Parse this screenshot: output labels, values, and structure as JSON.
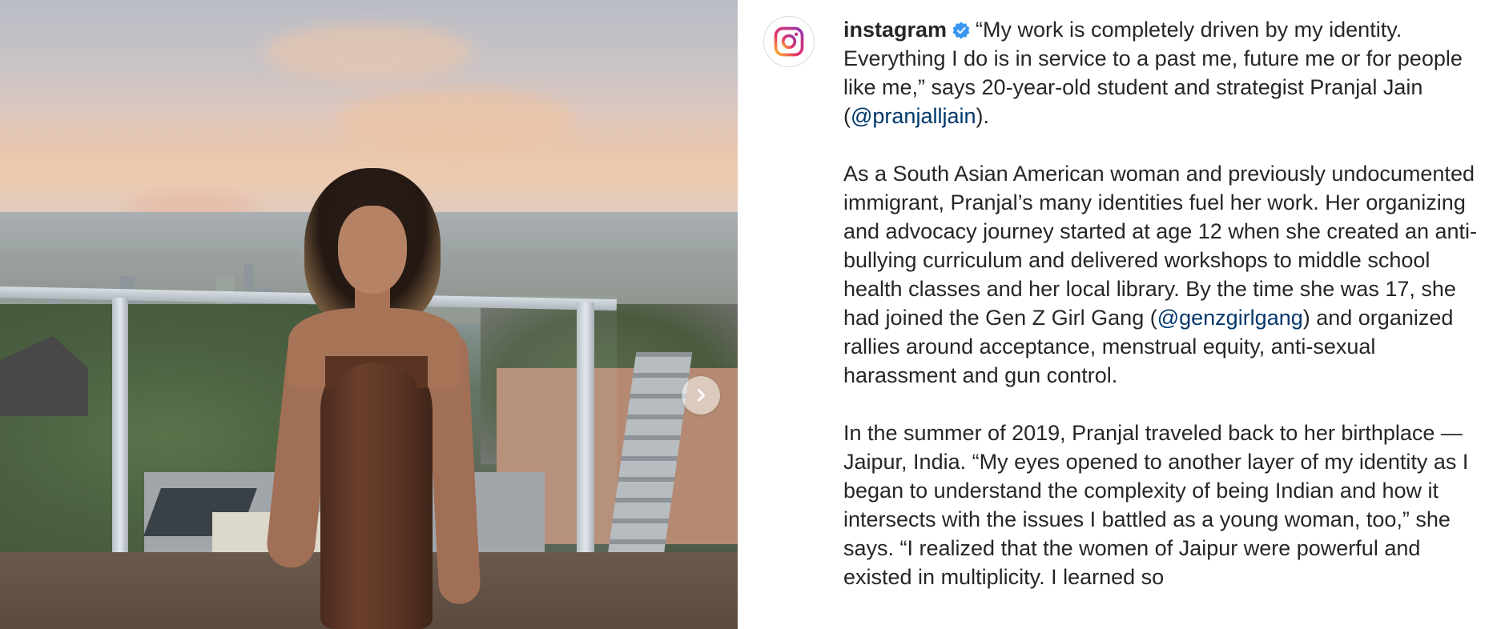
{
  "post": {
    "author": {
      "username": "instagram",
      "verified": true,
      "avatar_icon": "instagram-logo-icon",
      "verified_icon": "verified-badge-icon",
      "verified_color": "#3897f0"
    },
    "carousel": {
      "next_icon": "chevron-right-icon"
    },
    "caption": {
      "p1_a": "“My work is completely driven by my identity. Everything I do is in service to a past me, future me or for people like me,” says 20-year-old student and strategist Pranjal Jain (",
      "p1_mention": "@pranjalljain",
      "p1_b": ").",
      "p2_a": "As a South Asian American woman and previously undocumented immigrant, Pranjal’s many identities fuel her work. Her organizing and advocacy journey started at age 12 when she created an anti-bullying curriculum and delivered workshops to middle school health classes and her local library. By the time she was 17, she had joined the Gen Z Girl Gang (",
      "p2_mention": "@genzgirlgang",
      "p2_b": ") and organized rallies around acceptance, menstrual equity, anti-sexual harassment and gun control.",
      "p3": "In the summer of 2019, Pranjal traveled back to her birthplace — Jaipur, India. “My eyes opened to another layer of my identity as I began to understand the complexity of being Indian and how it intersects with the issues I battled as a young woman, too,” she says. “I realized that the women of Jaipur were powerful and existed in multiplicity. I learned so"
    },
    "colors": {
      "text": "#262626",
      "mention": "#00376b"
    }
  }
}
